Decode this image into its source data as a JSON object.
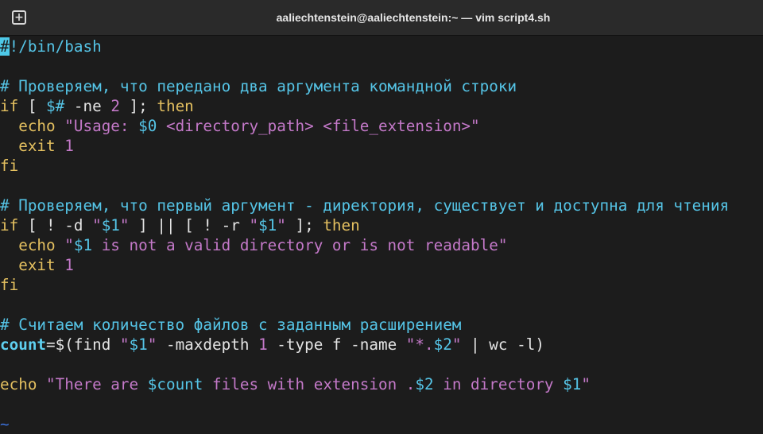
{
  "window": {
    "title": "aaliechtenstein@aaliechtenstein:~ — vim script4.sh",
    "new_tab_icon": "plus-in-square-icon"
  },
  "colors": {
    "background": "#1c1c1c",
    "titlebar": "#2a2a2a",
    "comment": "#55c4e6",
    "keyword": "#e4c060",
    "string": "#c479c9",
    "variable": "#55c4e6",
    "cursor": "#4ec9e8"
  },
  "code": {
    "l1_cursor": "#",
    "l1_rest": "!/bin/bash",
    "l3": "# Проверяем, что передано два аргумента командной строки",
    "l4_if": "if",
    "l4_a": " [ ",
    "l4_var": "$#",
    "l4_b": " -ne ",
    "l4_num": "2",
    "l4_c": " ]; ",
    "l4_then": "then",
    "l5_indent": "  ",
    "l5_echo": "echo",
    "l5_sp": " ",
    "l5_q1": "\"",
    "l5_str1": "Usage: ",
    "l5_var": "$0",
    "l5_str2": " <directory_path> <file_extension>",
    "l5_q2": "\"",
    "l6_indent": "  ",
    "l6_exit": "exit",
    "l6_sp": " ",
    "l6_num": "1",
    "l7": "fi",
    "l9": "# Проверяем, что первый аргумент - директория, существует и доступна для чтения",
    "l10_if": "if",
    "l10_a": " [ ! -d ",
    "l10_q1": "\"",
    "l10_v1": "$1",
    "l10_q2": "\"",
    "l10_b": " ] || [ ! -r ",
    "l10_q3": "\"",
    "l10_v2": "$1",
    "l10_q4": "\"",
    "l10_c": " ]; ",
    "l10_then": "then",
    "l11_indent": "  ",
    "l11_echo": "echo",
    "l11_sp": " ",
    "l11_q1": "\"",
    "l11_var": "$1",
    "l11_str": " is not a valid directory or is not readable",
    "l11_q2": "\"",
    "l12_indent": "  ",
    "l12_exit": "exit",
    "l12_sp": " ",
    "l12_num": "1",
    "l13": "fi",
    "l15": "# Считаем количество файлов с заданным расширением",
    "l16_var": "count",
    "l16_a": "=$(",
    "l16_find": "find",
    "l16_sp": " ",
    "l16_q1": "\"",
    "l16_v1": "$1",
    "l16_q2": "\"",
    "l16_b": " -maxdepth ",
    "l16_num": "1",
    "l16_c": " -type f -name ",
    "l16_q3": "\"",
    "l16_str": "*.",
    "l16_v2": "$2",
    "l16_q4": "\"",
    "l16_d": " | wc -l)",
    "l18_echo": "echo",
    "l18_sp": " ",
    "l18_q1": "\"",
    "l18_s1": "There are ",
    "l18_v1": "$count",
    "l18_s2": " files with extension .",
    "l18_v2": "$2",
    "l18_s3": " in directory ",
    "l18_v3": "$1",
    "l18_q2": "\"",
    "tilde": "~"
  }
}
